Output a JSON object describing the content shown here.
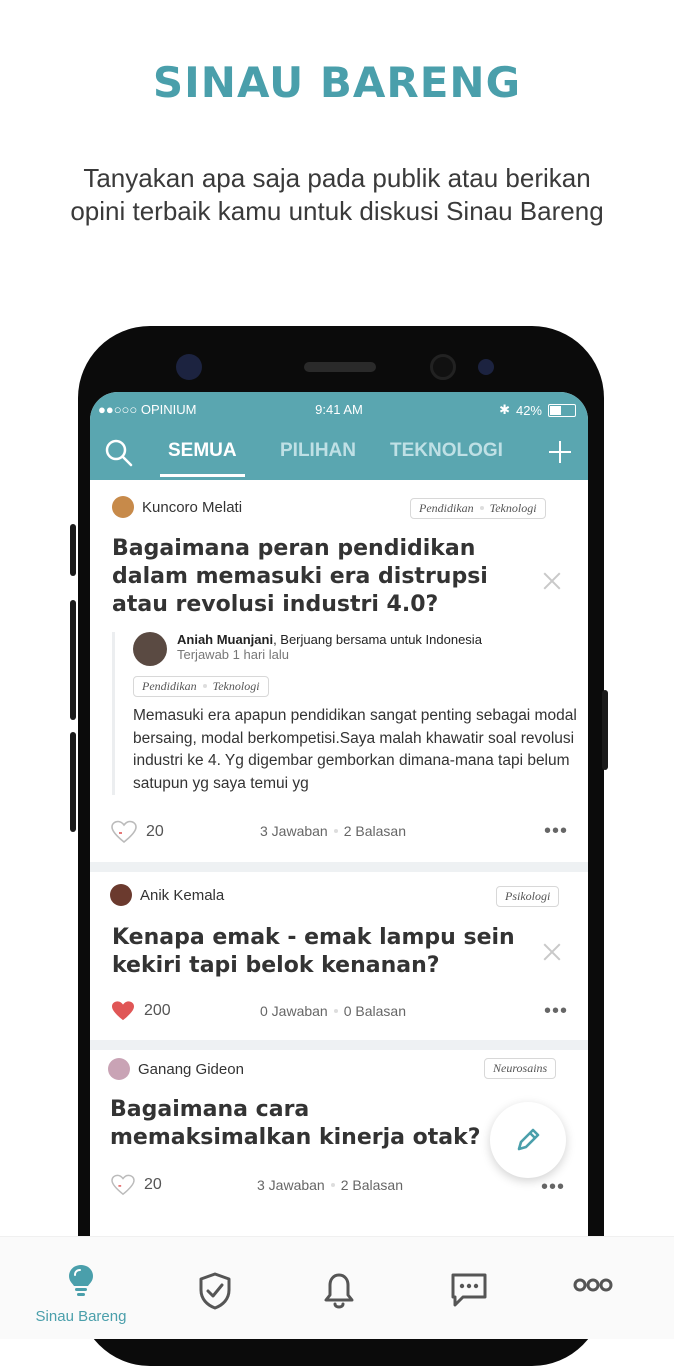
{
  "promo": {
    "headline": "SINAU BARENG",
    "subtitle": "Tanyakan apa saja pada publik atau berikan opini terbaik kamu untuk diskusi Sinau Bareng"
  },
  "status_bar": {
    "carrier": "●●○○○ OPINIUM",
    "time": "9:41 AM",
    "battery": "42%"
  },
  "tabs": [
    "SEMUA",
    "PILIHAN",
    "TEKNOLOGI"
  ],
  "active_tab": "SEMUA",
  "posts": [
    {
      "author": "Kuncoro Melati",
      "tags": [
        "Pendidikan",
        "Teknologi"
      ],
      "title": "Bagaimana peran pendidikan dalam memasuki era distrupsi atau revolusi industri 4.0?",
      "answer": {
        "author": "Aniah Muanjani",
        "bio": ", Berjuang bersama untuk Indonesia",
        "time": "Terjawab 1 hari lalu",
        "tags": [
          "Pendidikan",
          "Teknologi"
        ],
        "body": "Memasuki era apapun pendidikan sangat penting sebagai modal bersaing, modal berkompetisi.Saya malah khawatir soal revolusi industri ke 4. Yg digembar gemborkan dimana-mana tapi belum satupun yg saya temui yg"
      },
      "likes": "20",
      "answers": "3 Jawaban",
      "replies": "2 Balasan"
    },
    {
      "author": "Anik Kemala",
      "tags": [
        "Psikologi"
      ],
      "title": "Kenapa emak - emak lampu sein kekiri tapi belok kenanan?",
      "likes": "200",
      "answers": "0 Jawaban",
      "replies": "0 Balasan"
    },
    {
      "author": "Ganang Gideon",
      "tags": [
        "Neurosains"
      ],
      "title": "Bagaimana cara memaksimalkan kinerja otak?",
      "likes": "20",
      "answers": "3 Jawaban",
      "replies": "2 Balasan"
    }
  ],
  "more_label": "•••",
  "bottom_nav": {
    "active_label": "Sinau Bareng",
    "items": [
      "lightbulb-icon",
      "shield-check-icon",
      "bell-icon",
      "chat-icon",
      "more-icon"
    ]
  },
  "colors": {
    "accent": "#5aa6b0",
    "heart": "#e05656"
  }
}
